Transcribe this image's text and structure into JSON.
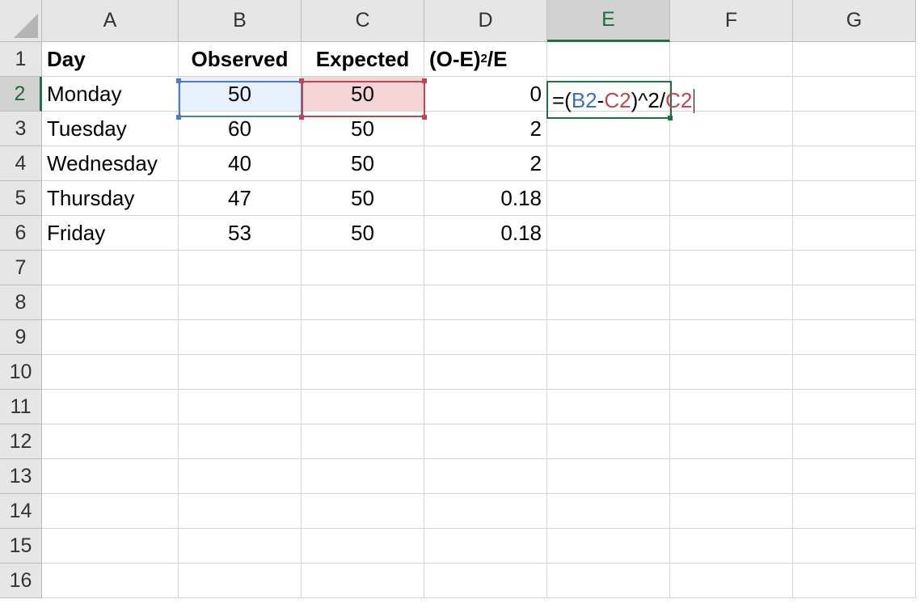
{
  "columns": [
    "A",
    "B",
    "C",
    "D",
    "E",
    "F",
    "G"
  ],
  "rows": [
    "1",
    "2",
    "3",
    "4",
    "5",
    "6",
    "7",
    "8",
    "9",
    "10",
    "11",
    "12",
    "13",
    "14",
    "15",
    "16"
  ],
  "headers": {
    "day": "Day",
    "observed": "Observed",
    "expected": "Expected",
    "stat_prefix": "(O-E)",
    "stat_exp": "2",
    "stat_suffix": "/E"
  },
  "data": [
    {
      "day": "Monday",
      "observed": "50",
      "expected": "50",
      "stat": "0"
    },
    {
      "day": "Tuesday",
      "observed": "60",
      "expected": "50",
      "stat": "2"
    },
    {
      "day": "Wednesday",
      "observed": "40",
      "expected": "50",
      "stat": "2"
    },
    {
      "day": "Thursday",
      "observed": "47",
      "expected": "50",
      "stat": "0.18"
    },
    {
      "day": "Friday",
      "observed": "53",
      "expected": "50",
      "stat": "0.18"
    }
  ],
  "formula": {
    "open": "=(",
    "ref1": "B2",
    "minus": "-",
    "ref2": "C2",
    "middle": ")^2/",
    "ref3": "C2"
  },
  "colors": {
    "active_cell": "#1e7145",
    "ref_blue": "#4a7cc7",
    "ref_red": "#c0464f"
  }
}
